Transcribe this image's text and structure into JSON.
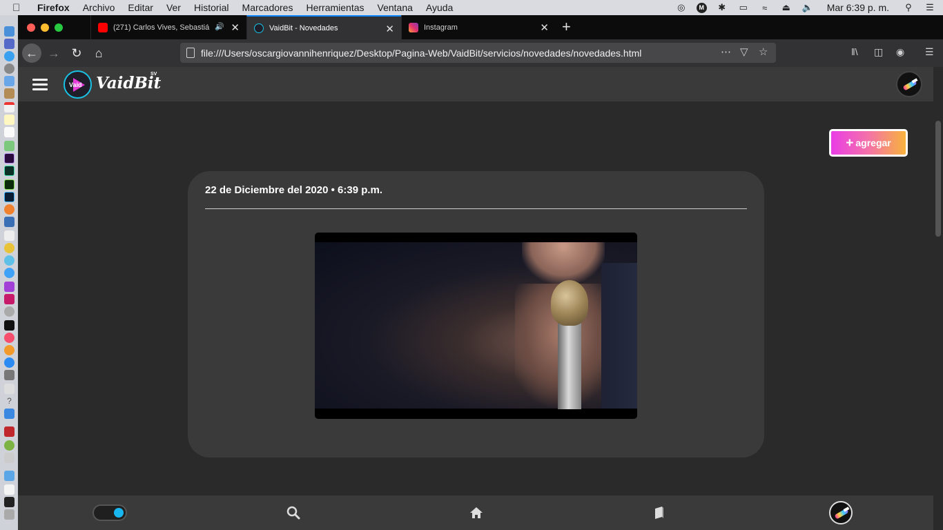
{
  "menubar": {
    "app": "Firefox",
    "items": [
      "Archivo",
      "Editar",
      "Ver",
      "Historial",
      "Marcadores",
      "Herramientas",
      "Ventana",
      "Ayuda"
    ],
    "clock": "Mar 6:39 p. m."
  },
  "tabs": [
    {
      "title": "(271) Carlos Vives, Sebastiá",
      "active": false
    },
    {
      "title": "VaidBit - Novedades",
      "active": true
    },
    {
      "title": "Instagram",
      "active": false
    }
  ],
  "url": "file:///Users/oscargiovannihenriquez/Desktop/Pagina-Web/VaidBit/servicios/novedades/novedades.html",
  "site": {
    "logo_badge": "Vaid",
    "logo_text": "VaidBit",
    "logo_sup": "SV",
    "add_button": "agregar"
  },
  "post": {
    "date": "22 de Diciembre del 2020 • 6:39 p.m."
  },
  "colors": {
    "accent_cyan": "#19c3e6",
    "accent_pink": "#e93de6",
    "accent_orange": "#f8b33c",
    "toggle_on": "#19b7f0"
  },
  "icons": {
    "nav": [
      "back-icon",
      "forward-icon",
      "reload-icon",
      "home-icon"
    ],
    "bottom": [
      "search-icon",
      "home-icon",
      "book-icon"
    ]
  },
  "dark_mode_toggle": {
    "on": true
  }
}
